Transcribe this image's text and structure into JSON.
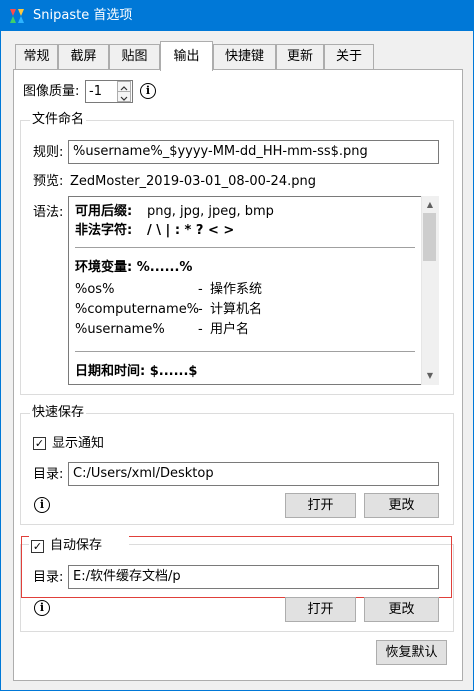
{
  "window": {
    "title": "Snipaste 首选项",
    "accent_color": "#0078d7"
  },
  "tabs": [
    {
      "label": "常规",
      "active": false
    },
    {
      "label": "截屏",
      "active": false
    },
    {
      "label": "贴图",
      "active": false
    },
    {
      "label": "输出",
      "active": true
    },
    {
      "label": "快捷键",
      "active": false
    },
    {
      "label": "更新",
      "active": false
    },
    {
      "label": "关于",
      "active": false
    }
  ],
  "image_quality": {
    "label": "图像质量:",
    "value": "-1"
  },
  "file_naming": {
    "legend": "文件命名",
    "rule_label": "规则:",
    "rule_value": "%username%_$yyyy-MM-dd_HH-mm-ss$.png",
    "preview_label": "预览:",
    "preview_value": "ZedMoster_2019-03-01_08-00-24.png",
    "syntax_label": "语法:",
    "syntax": {
      "suffix_label": "可用后缀:",
      "suffix_value": "png, jpg, jpeg, bmp",
      "illegal_label": "非法字符:",
      "illegal_value": "/ \\ | : * ? < >",
      "env_label": "环境变量: %......%",
      "env_vars": [
        {
          "name": "%os%",
          "dash": "-",
          "desc": "操作系统"
        },
        {
          "name": "%computername%",
          "dash": "-",
          "desc": "计算机名"
        },
        {
          "name": "%username%",
          "dash": "-",
          "desc": "用户名"
        }
      ],
      "datetime_label": "日期和时间: $......$"
    }
  },
  "quick_save": {
    "legend": "快速保存",
    "show_notify_label": "显示通知",
    "show_notify_checked": true,
    "dir_label": "目录:",
    "dir_value": "C:/Users/xml/Desktop",
    "open_label": "打开",
    "change_label": "更改"
  },
  "auto_save": {
    "label": "自动保存",
    "checked": true,
    "dir_label": "目录:",
    "dir_value": "E:/软件缓存文档/p",
    "open_label": "打开",
    "change_label": "更改",
    "highlight_color": "#e0403a"
  },
  "footer": {
    "restore_label": "恢复默认"
  }
}
